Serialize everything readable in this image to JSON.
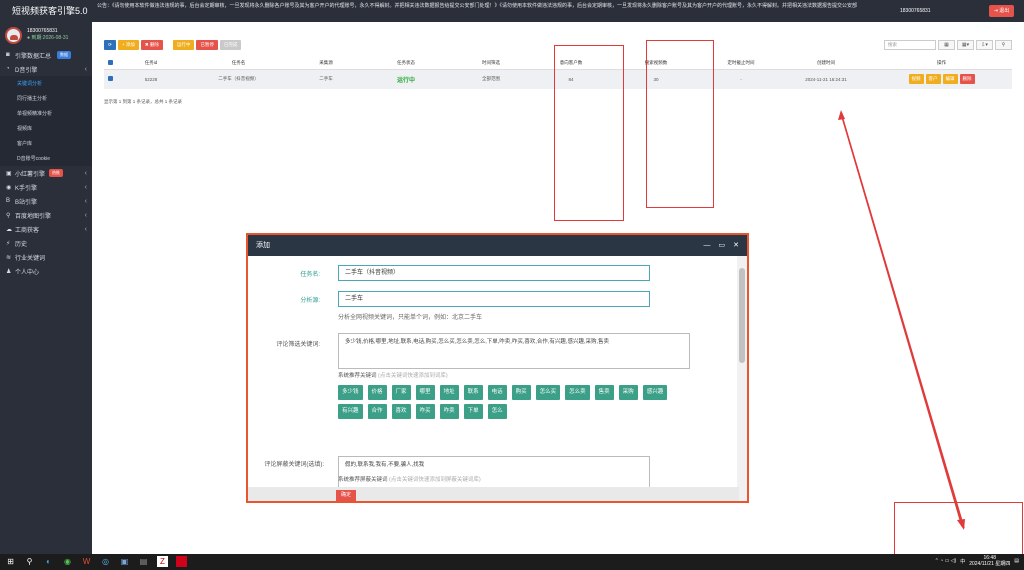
{
  "app": {
    "title": "短视频获客引擎5.0"
  },
  "user": {
    "name": "18300765831",
    "expiry": "● 到期:2026-08-31"
  },
  "notice": "公告：《请勿使用本软件做违法违规的事，后台会定期审核，一旦发现将永久删除各户账号及其为客户开户的代理账号，永久不得解封。并把相关违法数据报告给提交公安部门处理！》《请勿使用本软件做违法违规的事，后台会定期审核，一旦发现将永久删除客户账号及其为客户开户的代理账号，永久不得解封。并把相关违法数据报告提交公安部",
  "account_phone": "18300765831",
  "logout_label": "⇥ 退出",
  "sidebar": {
    "items": [
      {
        "icon": "◙",
        "label": "引擎数据汇总",
        "badge": "数据"
      },
      {
        "icon": "◔",
        "label": "D音引擎",
        "arrow": "‹"
      }
    ],
    "sub_items": [
      "关键词分析",
      "同行播主分析",
      "单视频精准分析",
      "视频库",
      "客户库",
      "D音账号cookie"
    ],
    "items2": [
      {
        "icon": "▣",
        "label": "小红薯引擎",
        "badge": "热推",
        "arrow": "‹"
      },
      {
        "icon": "◉",
        "label": "K手引擎",
        "arrow": "‹"
      },
      {
        "icon": "B",
        "label": "B站引擎",
        "arrow": "‹"
      },
      {
        "icon": "⚲",
        "label": "百度地图引擎",
        "arrow": "‹"
      },
      {
        "icon": "☁",
        "label": "工商获客",
        "arrow": "‹"
      },
      {
        "icon": "⚡",
        "label": "历史"
      },
      {
        "icon": "≋",
        "label": "行业关键词"
      },
      {
        "icon": "♟",
        "label": "个人中心"
      }
    ]
  },
  "toolbar": {
    "refresh": "⟳",
    "add": "+ 添加",
    "delete": "✖ 删除",
    "run": "运行中",
    "stopped": "已暂停",
    "done": "已完成",
    "search_placeholder": "搜索",
    "btn1": "▦",
    "btn2": "▦▾",
    "btn3": "⇩▾",
    "btn4": "⚲"
  },
  "table": {
    "headers": [
      "任务id",
      "任务名",
      "采集源",
      "任务状态",
      "时间筛选",
      "意向客户数",
      "搜索视频数",
      "定时截止时间",
      "创建时间",
      "操作"
    ],
    "row": [
      "52228",
      "二手车（抖音视频）",
      "二手车",
      "运行中",
      "全部范围",
      "84",
      "30",
      "-",
      "2024-11-21 16:24:31"
    ],
    "ops": [
      "视频",
      "客户",
      "编辑",
      "删除"
    ]
  },
  "pager": "显示第 1 到第 1 条记录，总共 1 条记录",
  "modal": {
    "title": "添加",
    "min": "—",
    "max": "▭",
    "close": "✕",
    "task_name_label": "任务名:",
    "task_name_value": "二手车（抖音视频）",
    "source_label": "分析源:",
    "source_value": "二手车",
    "source_hint": "分析全网视频关键词，只能单个词，例如：北京二手车",
    "filter_label": "评论筛选关键词:",
    "filter_value": "多少钱,价格,哪里,地址,联系,电话,购买,怎么买,怎么卖,怎么,下单,咋卖,咋买,喜欢,合作,有兴趣,感兴趣,采购,售卖",
    "rec_label": "系统推荐关键词",
    "rec_hint": "(点击关键词快速添加到词库)",
    "tags": [
      "多少钱",
      "价格",
      "厂家",
      "哪里",
      "地址",
      "联系",
      "电话",
      "购买",
      "怎么买",
      "怎么卖",
      "售卖",
      "采购",
      "感兴趣",
      "有兴趣",
      "合作",
      "喜欢",
      "咋买",
      "咋卖",
      "下单",
      "怎么"
    ],
    "block_label": "评论屏蔽关键词(选填):",
    "block_value": "假的,联系我,我有,不要,骗人,找我",
    "block_rec_label": "系统推荐屏蔽关键词",
    "block_rec_hint": "(点击关键词快速添加到屏蔽关键词库)",
    "ok_label": "确定"
  },
  "tray": {
    "time": "16:48",
    "date": "2024/11/21 星期四",
    "lang": "中"
  }
}
